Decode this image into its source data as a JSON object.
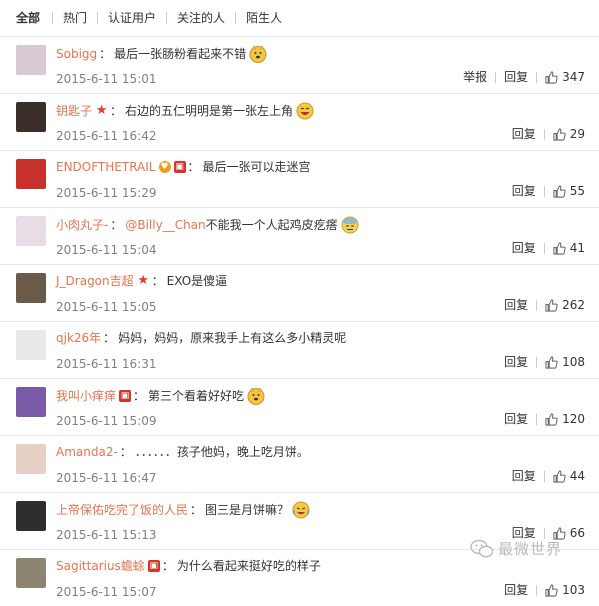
{
  "tabs": [
    "全部",
    "热门",
    "认证用户",
    "关注的人",
    "陌生人"
  ],
  "actions": {
    "report": "举报",
    "reply": "回复"
  },
  "colors": {
    "username": "#eb7350",
    "time": "#808080",
    "star_badge": "#e4392d",
    "gift_badge": "#d7352a"
  },
  "comments": [
    {
      "user": "Sobigg",
      "content": "最后一张肠粉看起来不错",
      "emoji": "doge-emoji",
      "time": "2015-6-11 15:01",
      "likes": "347",
      "show_report": true
    },
    {
      "user": "钥匙子",
      "badge": "star-badge",
      "content": "右边的五仁明明是第一张左上角",
      "emoji": "laugh-emoji",
      "time": "2015-6-11 16:42",
      "likes": "29"
    },
    {
      "user": "ENDOFTHETRAIL",
      "badge": "vip-gift-badges",
      "content": "最后一张可以走迷宫",
      "time": "2015-6-11 15:29",
      "likes": "55"
    },
    {
      "user": "小肉丸子-",
      "mention": "@Billy__Chan",
      "content": " 不能我一个人起鸡皮疙瘩",
      "emoji": "cold-sweat-emoji",
      "time": "2015-6-11 15:04",
      "likes": "41"
    },
    {
      "user": "J_Dragon吉超",
      "badge": "star-badge",
      "content": "EXO是傻逼",
      "time": "2015-6-11 15:05",
      "likes": "262"
    },
    {
      "user": "qjk26年",
      "content": "妈妈，妈妈，原来我手上有这么多小精灵呢",
      "time": "2015-6-11 16:31",
      "likes": "108"
    },
    {
      "user": "我叫小痒痒",
      "badge": "gift-badge",
      "content": "第三个看着好好吃",
      "emoji": "doge-emoji",
      "time": "2015-6-11 15:09",
      "likes": "120"
    },
    {
      "user": "Amanda2-",
      "content": "．．．．．．孩子他妈，晚上吃月饼。",
      "time": "2015-6-11 16:47",
      "likes": "44"
    },
    {
      "user": "上帝保佑吃完了饭的人民",
      "content": "图三是月饼嘛？",
      "emoji": "cry-laugh-emoji",
      "time": "2015-6-11 15:13",
      "likes": "66"
    },
    {
      "user": "Sagittarius蟾蜍",
      "badge": "gift-badge",
      "content": "为什么看起来挺好吃的样子",
      "time": "2015-6-11 15:07",
      "likes": "103"
    }
  ],
  "watermark": "最微世界"
}
